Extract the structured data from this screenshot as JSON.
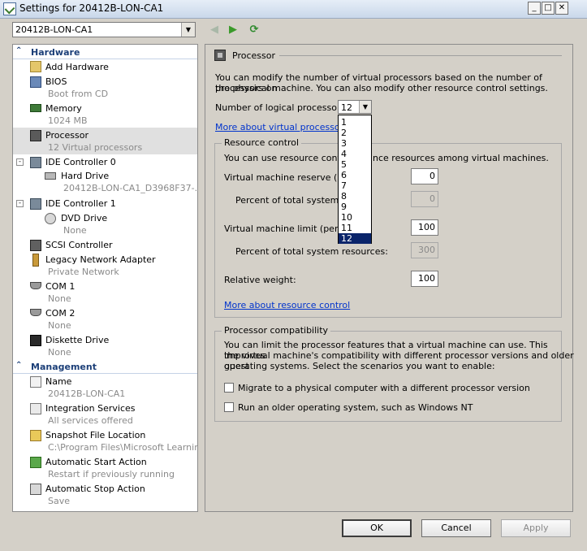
{
  "window": {
    "title": "Settings for 20412B-LON-CA1",
    "min": "_",
    "max": "□",
    "close": "✕"
  },
  "vm_selector": {
    "value": "20412B-LON-CA1",
    "arrow": "▼"
  },
  "nav": {
    "back": "◀",
    "forward": "▶",
    "refresh": "⟳"
  },
  "sidebar": {
    "collapse_glyph": "⌃",
    "hardware_label": "Hardware",
    "management_label": "Management",
    "hardware": [
      {
        "name": "Add Hardware",
        "sub": ""
      },
      {
        "name": "BIOS",
        "sub": "Boot from CD"
      },
      {
        "name": "Memory",
        "sub": "1024 MB"
      },
      {
        "name": "Processor",
        "sub": "12 Virtual processors"
      },
      {
        "name": "IDE Controller 0",
        "sub": ""
      },
      {
        "name": "Hard Drive",
        "sub": "20412B-LON-CA1_D3968F37-..."
      },
      {
        "name": "IDE Controller 1",
        "sub": ""
      },
      {
        "name": "DVD Drive",
        "sub": "None"
      },
      {
        "name": "SCSI Controller",
        "sub": ""
      },
      {
        "name": "Legacy Network Adapter",
        "sub": "Private Network"
      },
      {
        "name": "COM 1",
        "sub": "None"
      },
      {
        "name": "COM 2",
        "sub": "None"
      },
      {
        "name": "Diskette Drive",
        "sub": "None"
      }
    ],
    "management": [
      {
        "name": "Name",
        "sub": "20412B-LON-CA1"
      },
      {
        "name": "Integration Services",
        "sub": "All services offered"
      },
      {
        "name": "Snapshot File Location",
        "sub": "C:\\Program Files\\Microsoft Learnin..."
      },
      {
        "name": "Automatic Start Action",
        "sub": "Restart if previously running"
      },
      {
        "name": "Automatic Stop Action",
        "sub": "Save"
      }
    ]
  },
  "processor": {
    "header": "Processor",
    "intro_line1": "You can modify the number of virtual processors based on the number of processors on",
    "intro_line2": "the physical machine. You can also modify other resource control settings.",
    "num_label": "Number of logical processors:",
    "num_value": "12",
    "dropdown_arrow": "▼",
    "options": [
      "1",
      "2",
      "3",
      "4",
      "5",
      "6",
      "7",
      "8",
      "9",
      "10",
      "11",
      "12"
    ],
    "selected_option": "12",
    "more_link": "More about virtual processors",
    "resource_control": {
      "title": "Resource control",
      "desc": "You can use resource controls to balance resources among virtual machines.",
      "desc_left": "You can use resource controls",
      "desc_right": "nce resources among virtual machines.",
      "reserve_label": "Virtual machine reserve (perc",
      "reserve_value": "0",
      "reserve_pct_label": "Percent of total system re",
      "reserve_pct_value": "0",
      "limit_label": "Virtual machine limit (percenta",
      "limit_value": "100",
      "limit_pct_label": "Percent of total system resources:",
      "limit_pct_value": "300",
      "weight_label": "Relative weight:",
      "weight_value": "100",
      "more_link": "More about resource control"
    },
    "compat": {
      "title": "Processor compatibility",
      "desc1": "You can limit the processor features that a virtual machine can use. This improves",
      "desc2": "the virtual machine's compatibility with different processor versions and older guest",
      "desc3": "operating systems. Select the scenarios you want to enable:",
      "opt1": "Migrate to a physical computer with a different processor version",
      "opt2": "Run an older operating system, such as Windows NT"
    }
  },
  "buttons": {
    "ok": "OK",
    "cancel": "Cancel",
    "apply": "Apply"
  }
}
